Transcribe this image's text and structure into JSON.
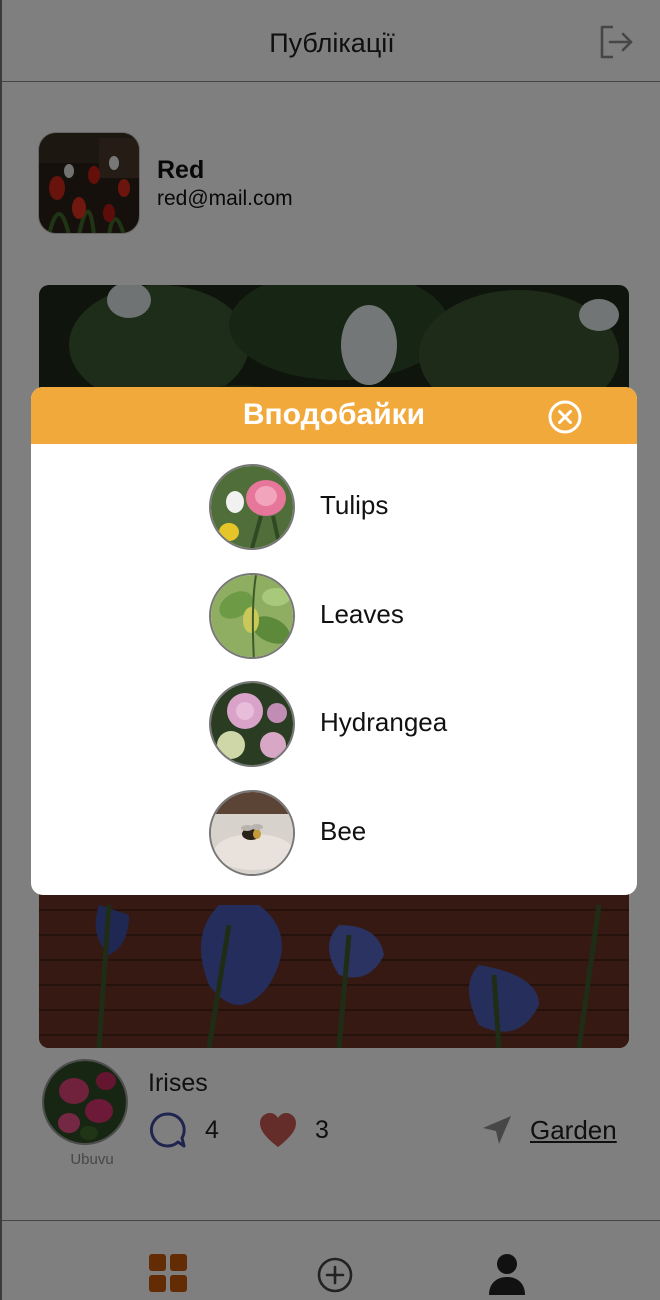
{
  "header": {
    "title": "Публікації",
    "logout_icon": "logout-icon"
  },
  "profile": {
    "name": "Red",
    "email": "red@mail.com"
  },
  "post": {
    "title": "Irises",
    "author": "Ubuvu",
    "comments_count": "4",
    "likes_count": "3",
    "location": "Garden"
  },
  "tabbar": {
    "icons": [
      "grid-icon",
      "add-icon",
      "user-icon"
    ],
    "active_color": "#c9580a"
  },
  "likes_modal": {
    "title": "Вподобайки",
    "header_color": "#f2a93b",
    "items": [
      {
        "label": "Tulips"
      },
      {
        "label": "Leaves"
      },
      {
        "label": "Hydrangea"
      },
      {
        "label": "Bee"
      }
    ]
  }
}
